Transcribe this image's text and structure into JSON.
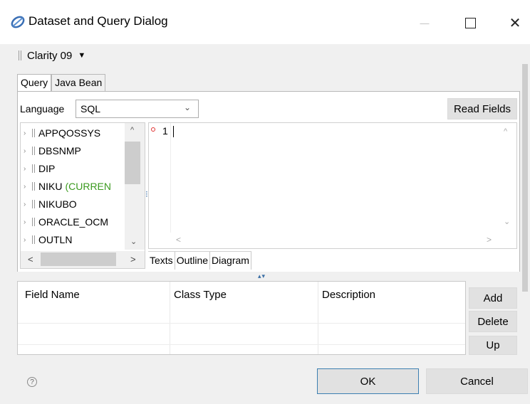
{
  "window": {
    "title": "Dataset and Query Dialog",
    "icon": "app-logo-icon",
    "minimize_glyph": "—",
    "maximize_glyph": "☐",
    "close_glyph": "✕"
  },
  "source": {
    "label": "Clarity 09",
    "arrow": "▼"
  },
  "tabs": [
    {
      "label": "Query",
      "active": true
    },
    {
      "label": "Java Bean",
      "active": false
    }
  ],
  "language": {
    "label": "Language",
    "value": "SQL",
    "chevron": "⌄"
  },
  "read_fields_label": "Read Fields",
  "schema_tree": {
    "items": [
      {
        "name": "APPQOSSYS",
        "suffix": ""
      },
      {
        "name": "DBSNMP",
        "suffix": ""
      },
      {
        "name": "DIP",
        "suffix": ""
      },
      {
        "name": "NIKU",
        "suffix": "(CURREN"
      },
      {
        "name": "NIKUBO",
        "suffix": ""
      },
      {
        "name": "ORACLE_OCM",
        "suffix": ""
      },
      {
        "name": "OUTLN",
        "suffix": ""
      }
    ],
    "expand_glyph": "›",
    "scroll_up": "^",
    "scroll_down": "⌄",
    "scroll_left": "<",
    "scroll_right": ">"
  },
  "editor": {
    "line_number": "1",
    "text": "",
    "scroll_up": "^",
    "scroll_down": "⌄",
    "scroll_left": "<",
    "scroll_right": ">"
  },
  "editor_tabs": [
    {
      "label": "Texts"
    },
    {
      "label": "Outline"
    },
    {
      "label": "Diagram"
    }
  ],
  "fields_table": {
    "columns": [
      "Field Name",
      "Class Type",
      "Description"
    ],
    "rows": []
  },
  "side_buttons": {
    "add": "Add",
    "delete": "Delete",
    "up": "Up"
  },
  "footer": {
    "help": "?",
    "ok": "OK",
    "cancel": "Cancel"
  },
  "colors": {
    "accent": "#3c7fb1",
    "current_schema": "#3b9a1f",
    "breakpoint": "#e03030"
  }
}
